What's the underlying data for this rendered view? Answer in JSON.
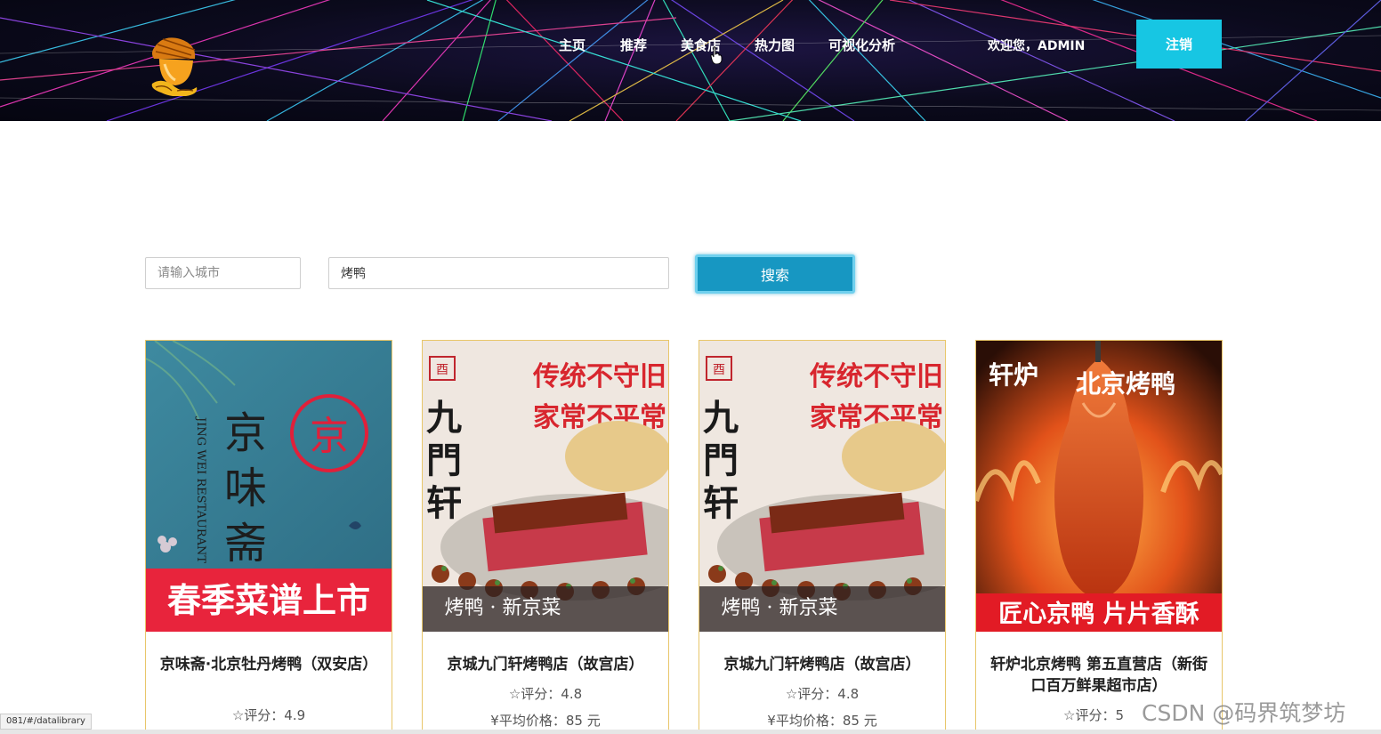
{
  "header": {
    "nav": [
      {
        "label": "主页",
        "name": "nav-home"
      },
      {
        "label": "推荐",
        "name": "nav-recommend"
      },
      {
        "label": "美食店",
        "name": "nav-restaurants"
      },
      {
        "label": "热力图",
        "name": "nav-heatmap"
      },
      {
        "label": "可视化分析",
        "name": "nav-visual-analysis"
      }
    ],
    "welcome": "欢迎您，ADMIN",
    "logout_label": "注销"
  },
  "search": {
    "city_placeholder": "请输入城市",
    "city_value": "",
    "keyword_value": "烤鸭",
    "button_label": "搜索"
  },
  "cards": [
    {
      "name": "京味斋·北京牡丹烤鸭（双安店）",
      "rating": "☆评分：4.9",
      "price": "",
      "banner": "春季菜谱上市",
      "brand": "京味斋",
      "brand_en": "JING WEI RESTAURANT",
      "seal": "京"
    },
    {
      "name": "京城九门轩烤鸭店（故宫店）",
      "rating": "☆评分：4.8",
      "price": "¥平均价格：85 元",
      "banner": "烤鸭 · 新京菜",
      "brand": "九門轩",
      "slogan1": "传统不守旧",
      "slogan2": "家常不平常"
    },
    {
      "name": "京城九门轩烤鸭店（故宫店）",
      "rating": "☆评分：4.8",
      "price": "¥平均价格：85 元",
      "banner": "烤鸭 · 新京菜",
      "brand": "九門轩",
      "slogan1": "传统不守旧",
      "slogan2": "家常不平常"
    },
    {
      "name": "轩炉北京烤鸭 第五直营店（新街口百万鲜果超市店）",
      "rating": "☆评分：5",
      "price": "",
      "banner": "匠心京鸭 片片香酥",
      "brand": "北京烤鸭",
      "logo_text": "轩炉"
    }
  ],
  "status_url": "081/#/datalibrary",
  "watermark": "CSDN @码界筑梦坊",
  "colors": {
    "accent": "#17c6e3",
    "search_button": "#1797c2",
    "card_border": "#e8c66a",
    "banner_red": "#e8243c"
  }
}
